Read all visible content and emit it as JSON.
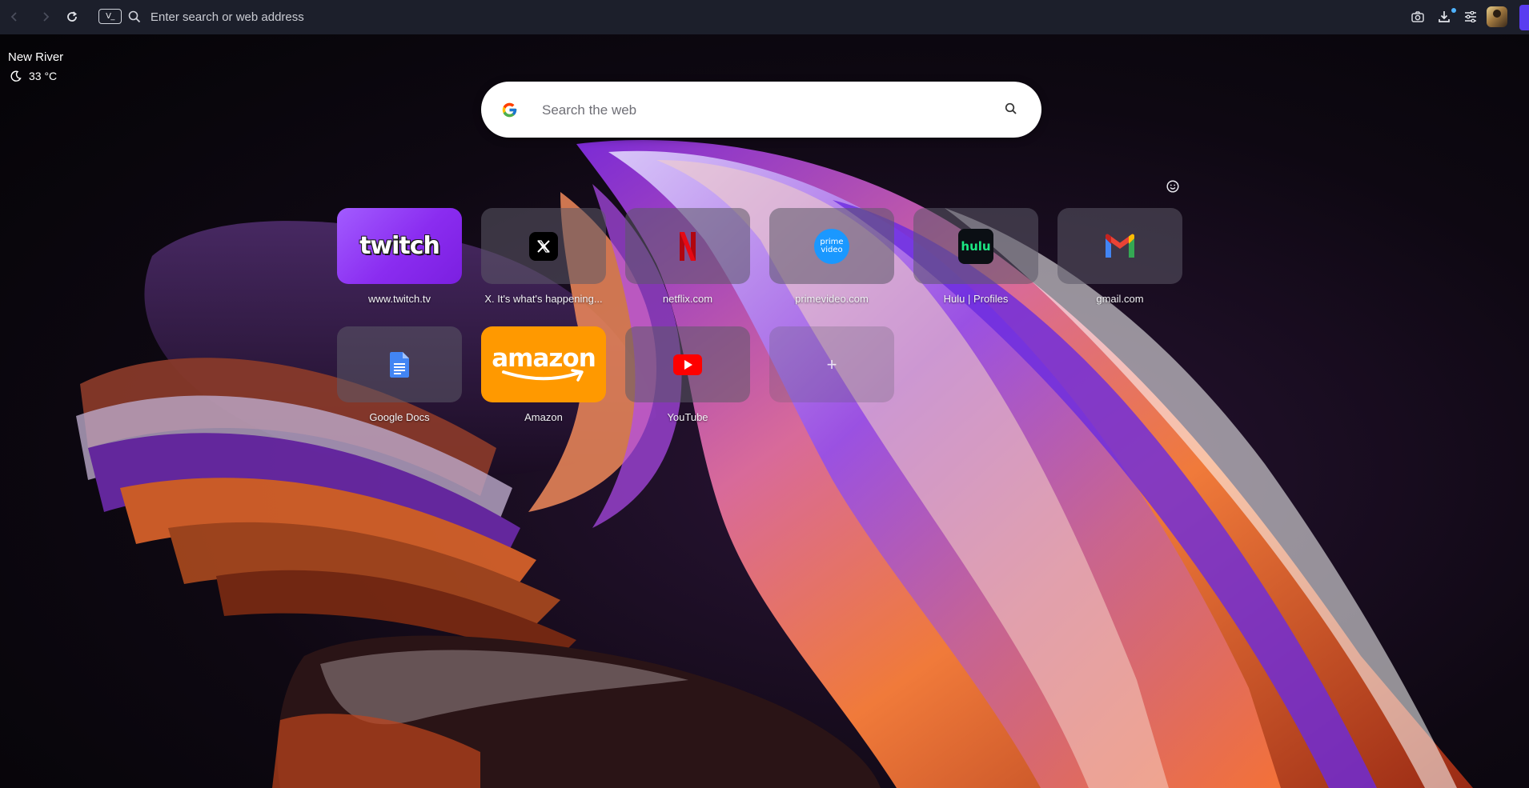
{
  "browser": {
    "address_placeholder": "Enter search or web address",
    "mode_chip": "V_",
    "icons": [
      "back-icon",
      "forward-icon",
      "reload-icon",
      "search-icon",
      "camera-icon",
      "download-icon",
      "menu-icon"
    ]
  },
  "weather": {
    "city": "New River",
    "temperature": "33 °C",
    "condition_icon": "moon-icon"
  },
  "search": {
    "placeholder": "Search the web",
    "engine_icon": "google-icon"
  },
  "speed_dials": [
    {
      "label": "www.twitch.tv",
      "icon": "twitch-logo",
      "logo_text": "twitch"
    },
    {
      "label": "X. It's what's happening...",
      "icon": "x-logo"
    },
    {
      "label": "netflix.com",
      "icon": "netflix-logo"
    },
    {
      "label": "primevideo.com",
      "icon": "prime-video-logo",
      "logo_text_1": "prime",
      "logo_text_2": "video"
    },
    {
      "label": "Hulu | Profiles",
      "icon": "hulu-logo",
      "logo_text": "hulu"
    },
    {
      "label": "gmail.com",
      "icon": "gmail-logo"
    },
    {
      "label": "Google Docs",
      "icon": "google-docs-logo"
    },
    {
      "label": "Amazon",
      "icon": "amazon-logo",
      "logo_text": "amazon"
    },
    {
      "label": "YouTube",
      "icon": "youtube-logo"
    },
    {
      "label": "",
      "icon": "plus-icon",
      "logo_text": "+"
    }
  ],
  "colors": {
    "toolbar": "#1c1f2b",
    "twitch": "#9146ff",
    "amazon": "#ff9900",
    "netflix": "#e50914",
    "youtube": "#ff0000",
    "hulu": "#1ce783",
    "prime": "#1a98ff"
  }
}
